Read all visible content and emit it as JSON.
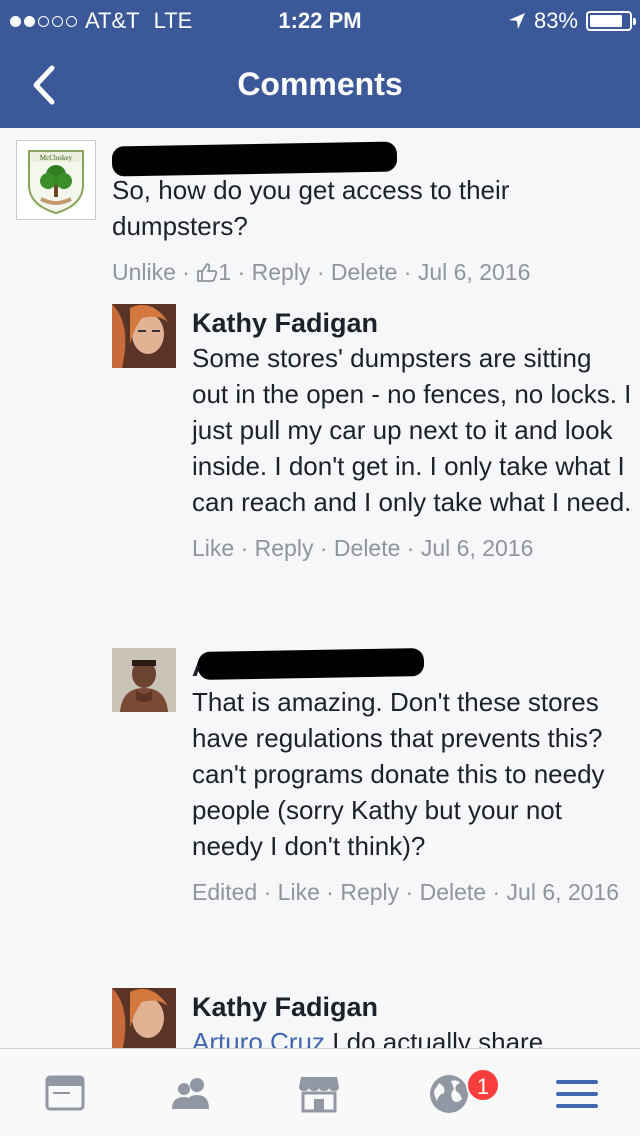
{
  "status_bar": {
    "carrier": "AT&T",
    "network": "LTE",
    "time": "1:22 PM",
    "battery": "83%",
    "battery_level": 0.83,
    "signal_bars": 2
  },
  "nav": {
    "title": "Comments",
    "back_icon": "chevron-left-icon"
  },
  "comments": [
    {
      "avatar_label": "McCloskey",
      "text": "So, how do you get access to their dumpsters?",
      "actions": {
        "like": "Unlike",
        "like_count": "1",
        "reply": "Reply",
        "delete": "Delete",
        "date": "Jul 6, 2016"
      }
    },
    {
      "author": "Kathy Fadigan",
      "text": "Some stores' dumpsters are sitting out in the open - no fences, no locks. I just pull my car up next to it and look inside. I don't get in. I only take what I can reach and I only take what I need.",
      "actions": {
        "like": "Like",
        "reply": "Reply",
        "delete": "Delete",
        "date": "Jul 6, 2016"
      }
    },
    {
      "author_initial": "A",
      "text": "That is amazing. Don't these stores have regulations that prevents this? can't programs donate this to needy people (sorry Kathy but your not needy I don't think)?",
      "actions": {
        "edited": "Edited",
        "like": "Like",
        "reply": "Reply",
        "delete": "Delete",
        "date": "Jul 6, 2016"
      }
    },
    {
      "author": "Kathy Fadigan",
      "mention": "Arturo Cruz",
      "text": "I do actually share"
    }
  ],
  "tab_bar": {
    "tabs": [
      "news-feed-icon",
      "friends-icon",
      "marketplace-icon",
      "notifications-globe-icon",
      "menu-icon"
    ],
    "notification_badge": "1",
    "active_color": "#4267b2",
    "inactive_color": "#9197a3"
  },
  "colors": {
    "header": "#3b5998",
    "background": "#f6f7f9",
    "meta_text": "#90949c",
    "badge": "#fa3e3e"
  }
}
